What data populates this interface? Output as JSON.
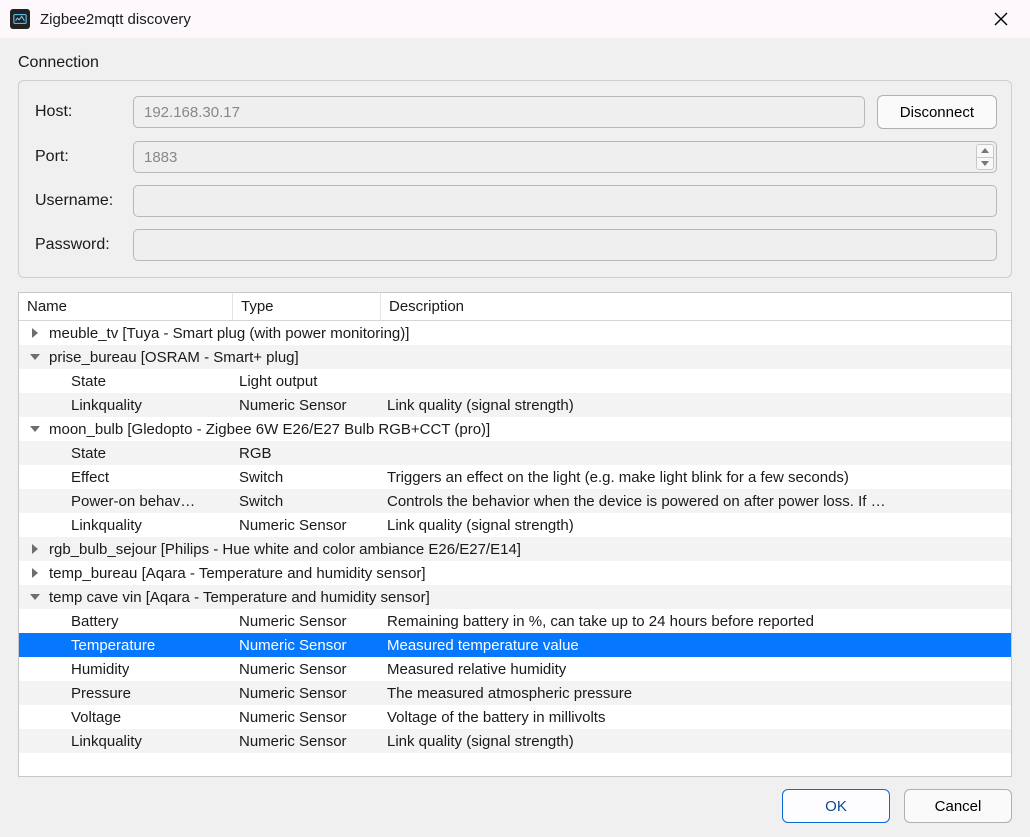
{
  "window": {
    "title": "Zigbee2mqtt discovery"
  },
  "connection": {
    "section_label": "Connection",
    "host_label": "Host:",
    "host_value": "192.168.30.17",
    "port_label": "Port:",
    "port_value": "1883",
    "username_label": "Username:",
    "username_value": "",
    "password_label": "Password:",
    "password_value": "",
    "disconnect_label": "Disconnect"
  },
  "columns": {
    "name": "Name",
    "type": "Type",
    "description": "Description"
  },
  "tree": [
    {
      "kind": "group",
      "expanded": false,
      "label": "meuble_tv [Tuya - Smart plug (with power monitoring)]"
    },
    {
      "kind": "group",
      "expanded": true,
      "label": "prise_bureau [OSRAM - Smart+ plug]"
    },
    {
      "kind": "child",
      "name": "State",
      "type": "Light output",
      "desc": ""
    },
    {
      "kind": "child",
      "name": "Linkquality",
      "type": "Numeric Sensor",
      "desc": "Link quality (signal strength)"
    },
    {
      "kind": "group",
      "expanded": true,
      "label": "moon_bulb [Gledopto - Zigbee 6W E26/E27 Bulb RGB+CCT (pro)]"
    },
    {
      "kind": "child",
      "name": "State",
      "type": "RGB",
      "desc": ""
    },
    {
      "kind": "child",
      "name": "Effect",
      "type": "Switch",
      "desc": "Triggers an effect on the light (e.g. make light blink for a few seconds)"
    },
    {
      "kind": "child",
      "name": "Power-on behav…",
      "type": "Switch",
      "desc": "Controls the behavior when the device is powered on after power loss. If …"
    },
    {
      "kind": "child",
      "name": "Linkquality",
      "type": "Numeric Sensor",
      "desc": "Link quality (signal strength)"
    },
    {
      "kind": "group",
      "expanded": false,
      "label": "rgb_bulb_sejour [Philips - Hue white and color ambiance E26/E27/E14]"
    },
    {
      "kind": "group",
      "expanded": false,
      "label": "temp_bureau [Aqara - Temperature and humidity sensor]"
    },
    {
      "kind": "group",
      "expanded": true,
      "label": "temp cave vin [Aqara - Temperature and humidity sensor]"
    },
    {
      "kind": "child",
      "name": "Battery",
      "type": "Numeric Sensor",
      "desc": "Remaining battery in %, can take up to 24 hours before reported"
    },
    {
      "kind": "child",
      "name": "Temperature",
      "type": "Numeric Sensor",
      "desc": "Measured temperature value",
      "selected": true
    },
    {
      "kind": "child",
      "name": "Humidity",
      "type": "Numeric Sensor",
      "desc": "Measured relative humidity"
    },
    {
      "kind": "child",
      "name": "Pressure",
      "type": "Numeric Sensor",
      "desc": "The measured atmospheric pressure"
    },
    {
      "kind": "child",
      "name": "Voltage",
      "type": "Numeric Sensor",
      "desc": "Voltage of the battery in millivolts"
    },
    {
      "kind": "child",
      "name": "Linkquality",
      "type": "Numeric Sensor",
      "desc": "Link quality (signal strength)"
    }
  ],
  "footer": {
    "ok_label": "OK",
    "cancel_label": "Cancel"
  }
}
